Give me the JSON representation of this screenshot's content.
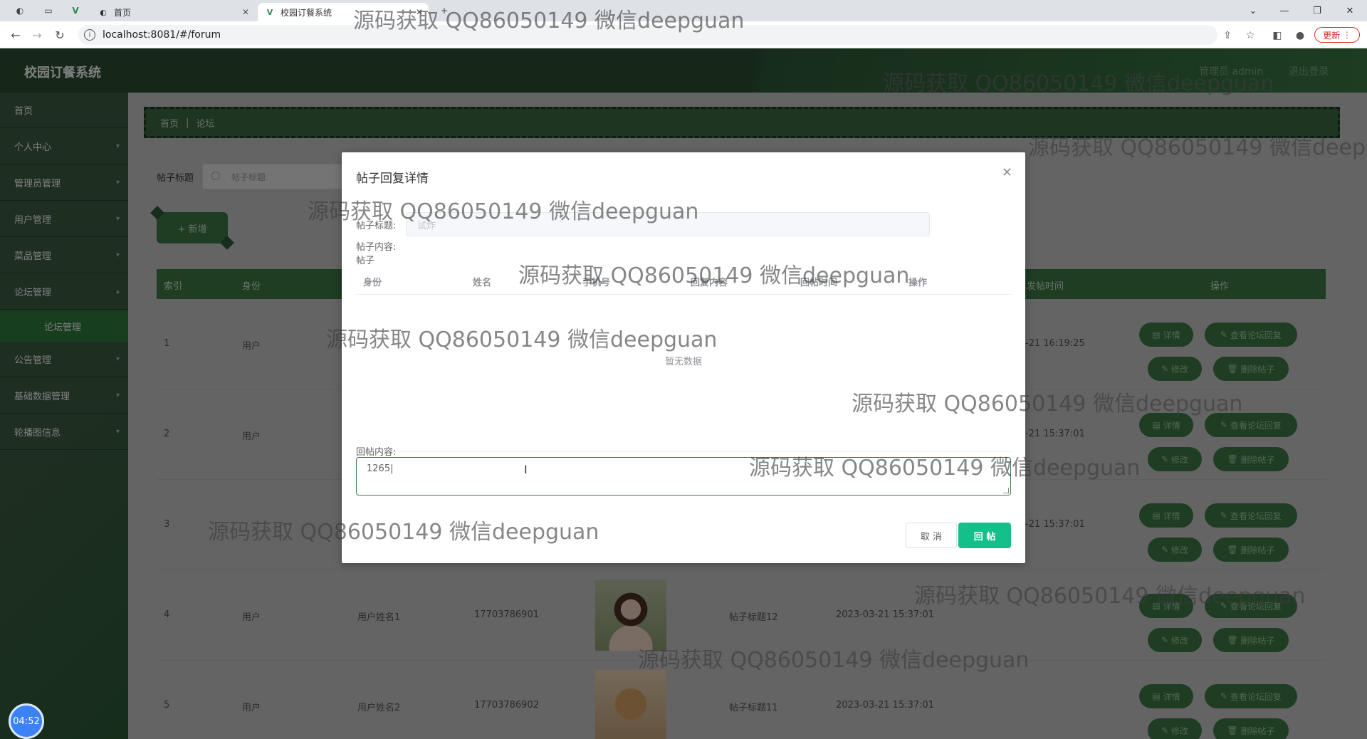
{
  "browser": {
    "tabs": [
      {
        "title": "首页"
      },
      {
        "title": "校园订餐系统"
      }
    ],
    "url": "localhost:8081/#/forum",
    "update_label": "更新"
  },
  "app": {
    "title": "校园订餐系统",
    "user_label": "管理员 admin",
    "logout_label": "退出登录"
  },
  "sidebar": {
    "items": [
      {
        "label": "首页"
      },
      {
        "label": "个人中心"
      },
      {
        "label": "管理员管理"
      },
      {
        "label": "用户管理"
      },
      {
        "label": "菜品管理"
      },
      {
        "label": "论坛管理"
      },
      {
        "label": "公告管理"
      },
      {
        "label": "基础数据管理"
      },
      {
        "label": "轮播图信息"
      }
    ],
    "sub_active": "论坛管理",
    "clock": "04:52"
  },
  "main": {
    "breadcrumb": [
      "首页",
      "论坛"
    ],
    "search_label": "帖子标题",
    "search_placeholder": "帖子标题",
    "add_label": "+ 新增",
    "columns": {
      "index": "索引",
      "role": "身份",
      "post_time": "发帖时间",
      "actions": "操作"
    },
    "rows": [
      {
        "index": "1",
        "role": "用户",
        "name": "",
        "phone": "",
        "title": "",
        "time": "-21 16:19:25"
      },
      {
        "index": "2",
        "role": "用户",
        "name": "",
        "phone": "",
        "title": "",
        "time": "-21 15:37:01"
      },
      {
        "index": "3",
        "role": "",
        "name": "",
        "phone": "",
        "title": "",
        "time": "-21 15:37:01"
      },
      {
        "index": "4",
        "role": "用户",
        "name": "用户姓名1",
        "phone": "17703786901",
        "title": "帖子标题12",
        "time": "2023-03-21 15:37:01"
      },
      {
        "index": "5",
        "role": "用户",
        "name": "用户姓名2",
        "phone": "17703786902",
        "title": "帖子标题11",
        "time": "2023-03-21 15:37:01"
      }
    ],
    "action_labels": {
      "detail": "详情",
      "view_replies": "查看论坛回复",
      "edit": "修改",
      "delete": "删除帖子"
    }
  },
  "dialog": {
    "title": "帖子回复详情",
    "post_title_label": "帖子标题:",
    "post_title_value": "试炸",
    "post_content_label": "帖子内容:",
    "post_content_value": "帖子",
    "table_columns": [
      "身份",
      "姓名",
      "手机号",
      "回复内容",
      "回帖时间",
      "操作"
    ],
    "empty_text": "暂无数据",
    "reply_label": "回帖内容:",
    "reply_value": "1265",
    "cancel_label": "取 消",
    "submit_label": "回 帖"
  },
  "watermark": "源码获取 QQ86050149 微信deepguan"
}
